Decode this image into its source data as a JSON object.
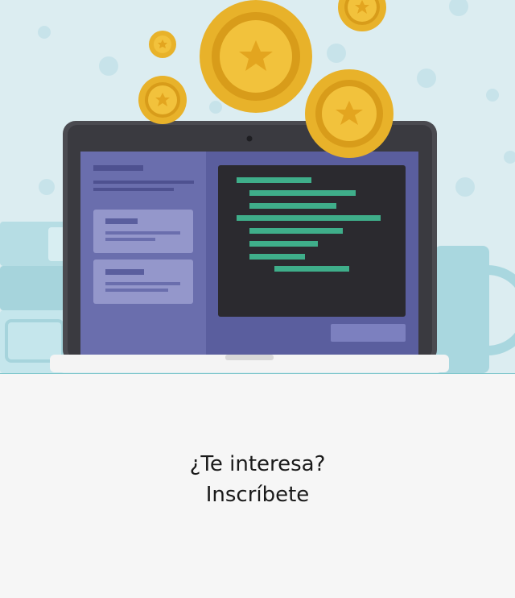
{
  "hero": {
    "illustration": "laptop-code-editor-with-gold-coins",
    "colors": {
      "background": "#dcedf1",
      "laptop_frame": "#4a4a50",
      "sidebar": "#6a6ead",
      "editor_panel": "#5a5e9e",
      "code_line": "#3fae8a",
      "coin_gold": "#e8b22a",
      "mug": "#a9d7df"
    }
  },
  "cta": {
    "line1": "¿Te interesa?",
    "line2": "Inscríbete"
  }
}
